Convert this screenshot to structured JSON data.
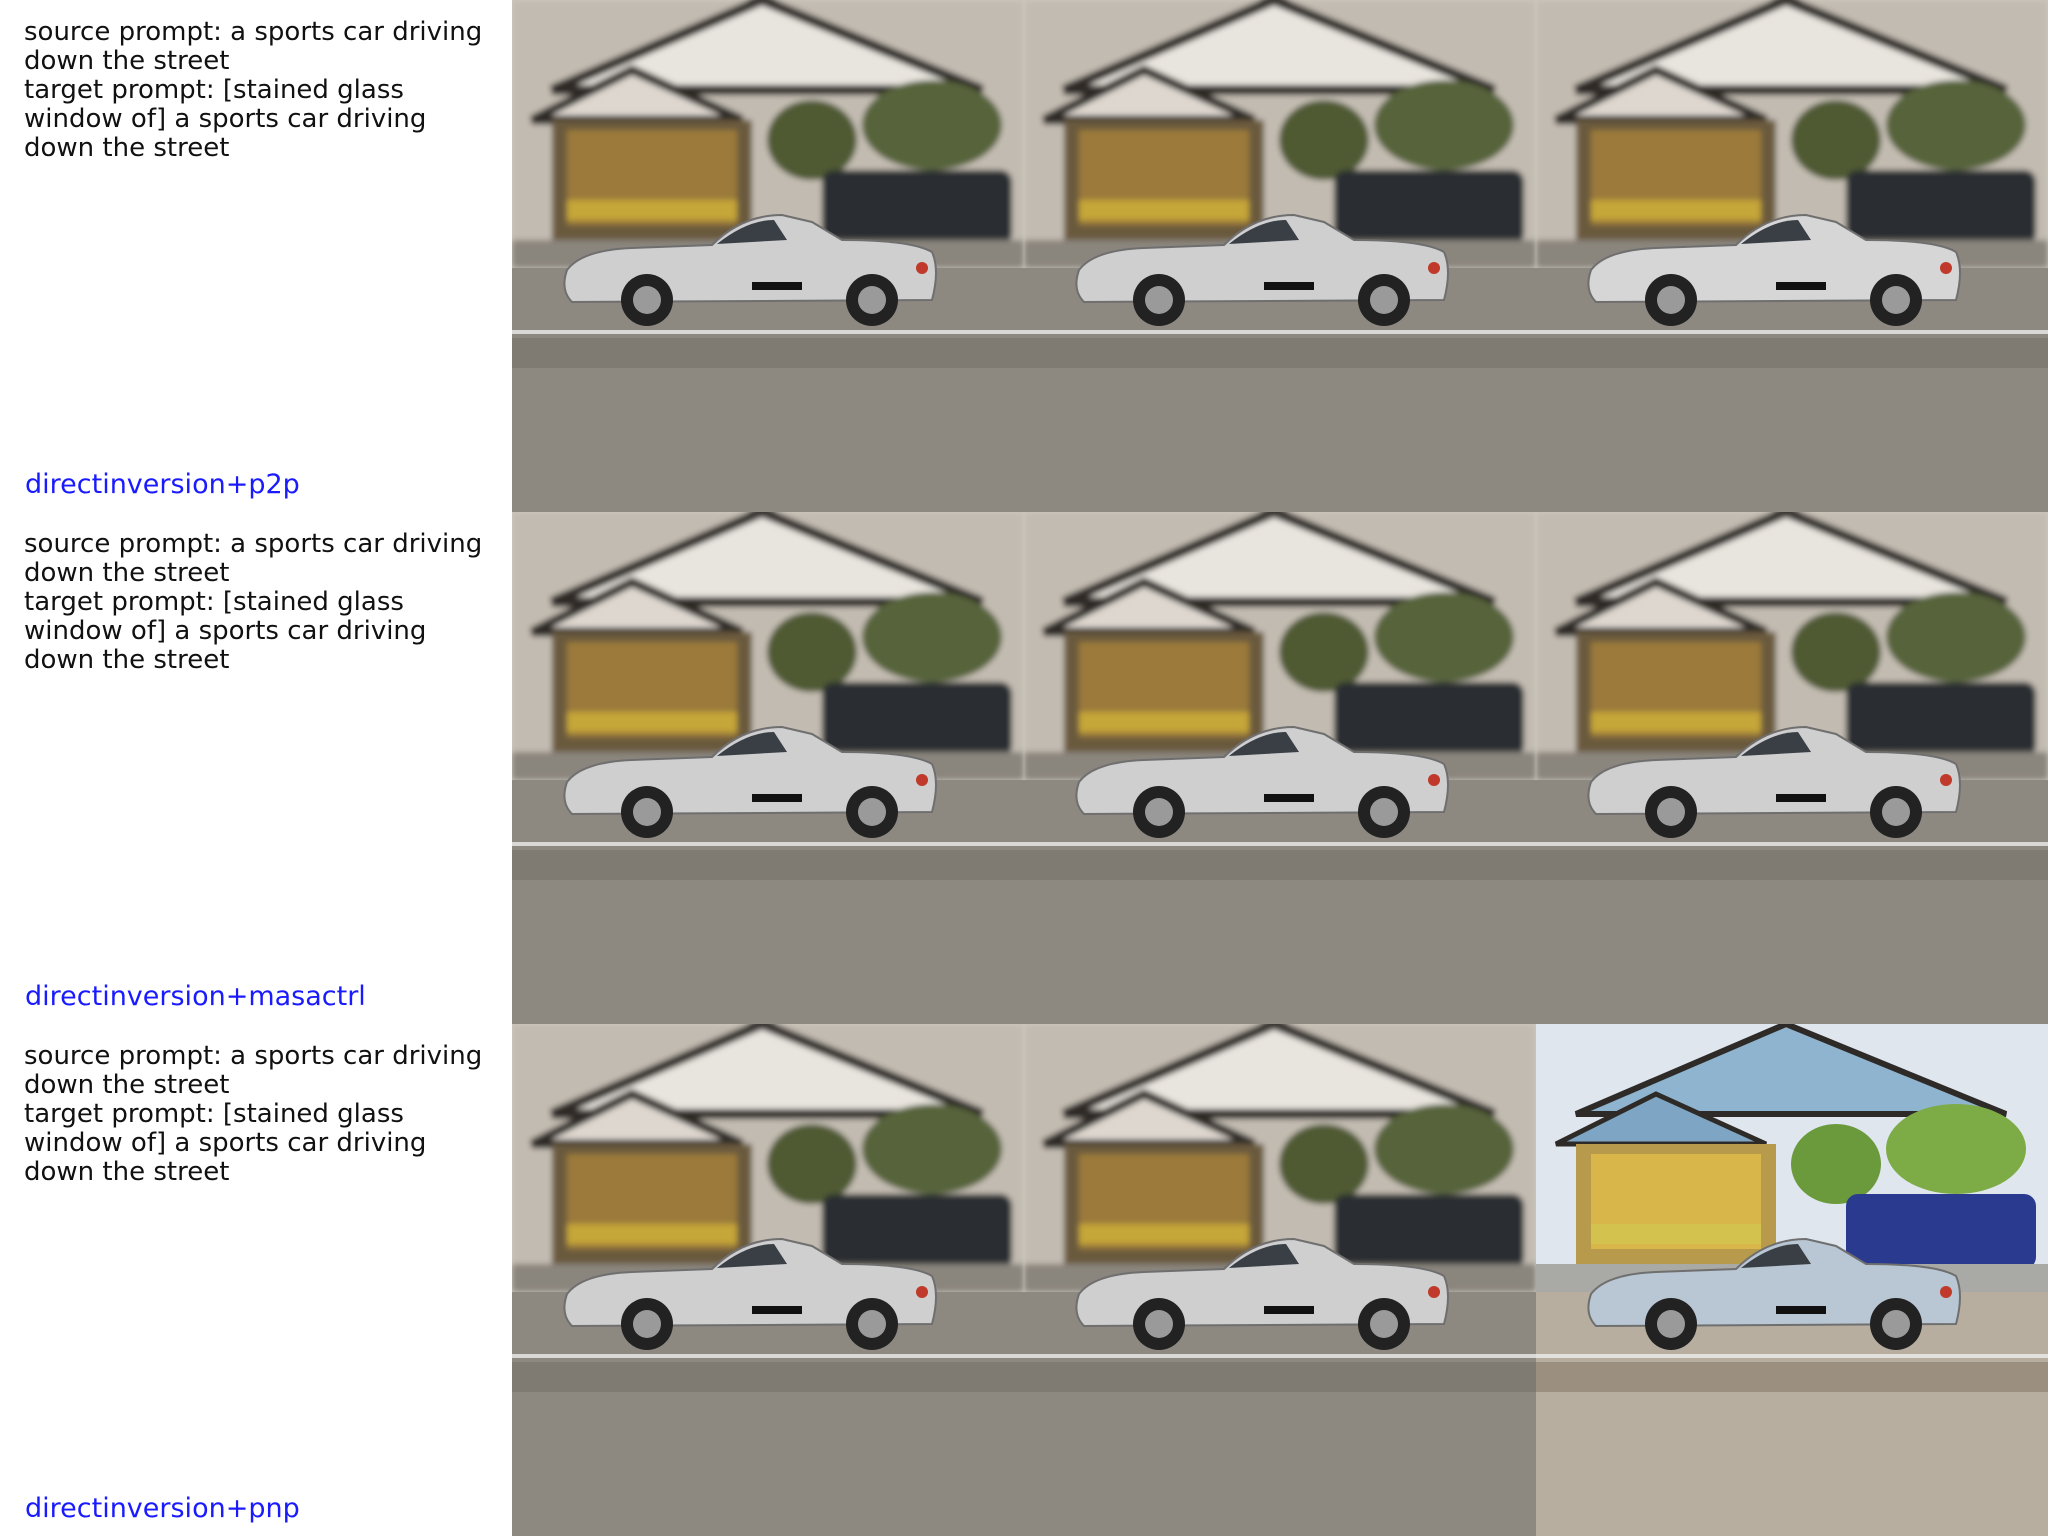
{
  "rows": [
    {
      "source_prompt": "source prompt: a sports car driving down the street",
      "target_prompt": "target prompt: [stained glass window of] a sports car driving down the street",
      "method": "directinversion+p2p",
      "images": [
        {
          "style": "blurred-photo",
          "description_icon": "car-image"
        },
        {
          "style": "blurred-photo",
          "description_icon": "car-image"
        },
        {
          "style": "blurred-photo-edited",
          "description_icon": "car-image"
        }
      ]
    },
    {
      "source_prompt": "source prompt: a sports car driving down the street",
      "target_prompt": "target prompt: [stained glass window of] a sports car driving down the street",
      "method": "directinversion+masactrl",
      "images": [
        {
          "style": "blurred-photo",
          "description_icon": "car-image"
        },
        {
          "style": "blurred-photo",
          "description_icon": "car-image"
        },
        {
          "style": "blurred-photo",
          "description_icon": "car-image"
        }
      ]
    },
    {
      "source_prompt": "source prompt: a sports car driving down the street",
      "target_prompt": "target prompt: [stained glass window of] a sports car driving down the street",
      "method": "directinversion+pnp",
      "images": [
        {
          "style": "blurred-photo",
          "description_icon": "car-image"
        },
        {
          "style": "blurred-photo",
          "description_icon": "car-image"
        },
        {
          "style": "painted-illustration",
          "description_icon": "car-image"
        }
      ]
    }
  ],
  "colors": {
    "method_label": "#1a1aff",
    "prompt_text": "#111111"
  }
}
